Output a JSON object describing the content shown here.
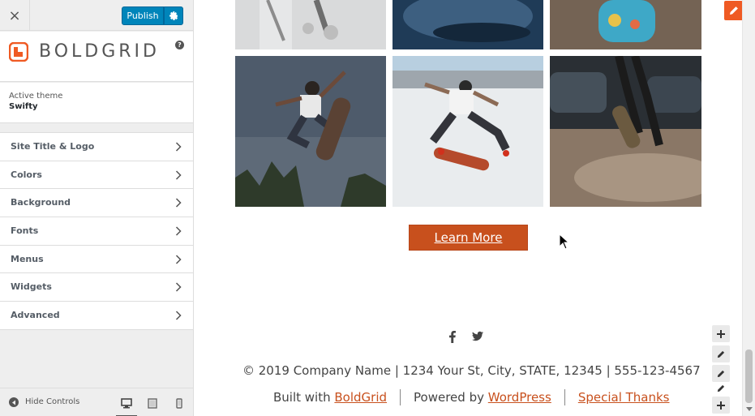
{
  "customizer": {
    "close_symbol": "×",
    "publish_label": "Publish",
    "brand_name": "BOLDGRID",
    "help_symbol": "?",
    "active_theme_label": "Active theme",
    "active_theme_name": "Swifty",
    "sections": [
      {
        "label": "Site Title & Logo"
      },
      {
        "label": "Colors"
      },
      {
        "label": "Background"
      },
      {
        "label": "Fonts"
      },
      {
        "label": "Menus"
      },
      {
        "label": "Widgets"
      },
      {
        "label": "Advanced"
      }
    ],
    "hide_controls_label": "Hide Controls",
    "devices": [
      "desktop-icon",
      "tablet-icon",
      "mobile-icon"
    ]
  },
  "preview": {
    "learn_more_label": "Learn More",
    "social_icons": [
      "facebook-icon",
      "twitter-icon"
    ],
    "copyright": "© 2019 Company Name | 1234 Your St, City, STATE, 12345 | 555-123-4567",
    "credits": {
      "built_with_prefix": "Built with",
      "built_with_link": "BoldGrid",
      "powered_by_prefix": "Powered by",
      "powered_by_link": "WordPress",
      "special_thanks_link": "Special Thanks"
    }
  },
  "colors": {
    "accent": "#c8501d",
    "publish_blue": "#0085ba",
    "edit_orange": "#ef5a23"
  }
}
